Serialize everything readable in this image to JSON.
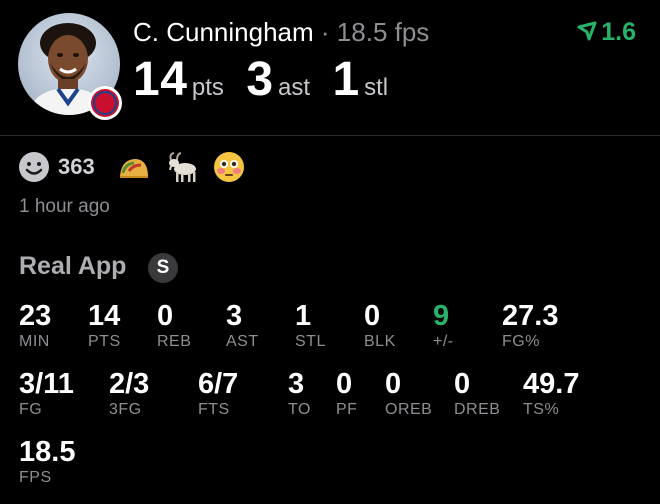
{
  "header": {
    "player_name": "C. Cunningham",
    "separator": "·",
    "fps_text": "18.5 fps",
    "stats": [
      {
        "value": "14",
        "unit": "pts"
      },
      {
        "value": "3",
        "unit": "ast"
      },
      {
        "value": "1",
        "unit": "stl"
      }
    ],
    "change": "1.6",
    "change_color": "#27b36a",
    "avatar_icon": "player-headshot",
    "team_badge_text": "DETROIT PISTONS",
    "team_color": "#c8102e"
  },
  "reactions": {
    "smile_count": "363",
    "items": [
      "smile-face-icon",
      "taco-icon",
      "goat-icon",
      "flushed-face-icon"
    ]
  },
  "timestamp": "1 hour ago",
  "app": {
    "title": "Real App",
    "badge": "S"
  },
  "box_score": [
    {
      "value": "23",
      "label": "MIN"
    },
    {
      "value": "14",
      "label": "PTS"
    },
    {
      "value": "0",
      "label": "REB"
    },
    {
      "value": "3",
      "label": "AST"
    },
    {
      "value": "1",
      "label": "STL"
    },
    {
      "value": "0",
      "label": "BLK"
    },
    {
      "value": "9",
      "label": "+/-",
      "highlight": true
    },
    {
      "value": "27.3",
      "label": "FG%"
    },
    {
      "value": "3/11",
      "label": "FG"
    },
    {
      "value": "2/3",
      "label": "3FG"
    },
    {
      "value": "6/7",
      "label": "FTS"
    },
    {
      "value": "3",
      "label": "TO"
    },
    {
      "value": "0",
      "label": "PF"
    },
    {
      "value": "0",
      "label": "OREB"
    },
    {
      "value": "0",
      "label": "DREB"
    },
    {
      "value": "49.7",
      "label": "TS%"
    },
    {
      "value": "18.5",
      "label": "FPS"
    }
  ]
}
